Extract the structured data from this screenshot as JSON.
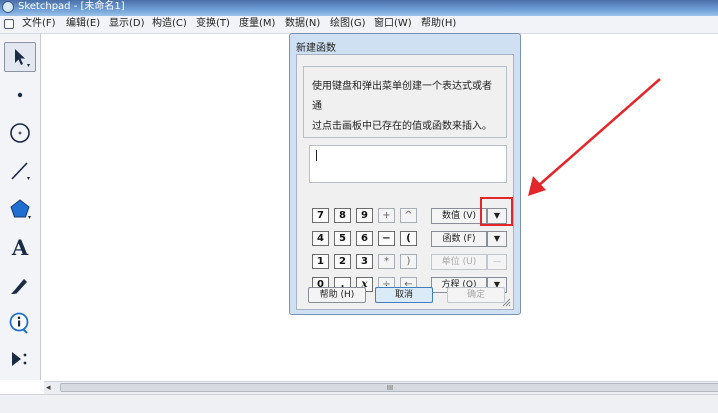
{
  "window": {
    "title": "Sketchpad - [未命名1]"
  },
  "menu": [
    "文件(F)",
    "编辑(E)",
    "显示(D)",
    "构造(C)",
    "变换(T)",
    "度量(M)",
    "数据(N)",
    "绘图(G)",
    "窗口(W)",
    "帮助(H)"
  ],
  "toolbox": {
    "tools": [
      "arrow-select-tool",
      "point-tool",
      "compass-tool",
      "straightedge-tool",
      "polygon-tool",
      "text-tool",
      "marker-tool",
      "information-tool",
      "custom-tool"
    ],
    "text_tool_glyph": "A"
  },
  "scrollbar": {
    "grip": "III"
  },
  "dialog": {
    "title": "新建函数",
    "instructions_line1": "使用键盘和弹出菜单创建一个表达式或者通",
    "instructions_line2": "过点击画板中已存在的值或函数来插入。",
    "expression_value": "",
    "keypad": {
      "r1": [
        "7",
        "8",
        "9",
        "+",
        "^"
      ],
      "r2": [
        "4",
        "5",
        "6",
        "−",
        "("
      ],
      "r3": [
        "1",
        "2",
        "3",
        "*",
        ")"
      ],
      "r4": [
        "0",
        ".",
        "x",
        "÷",
        "←"
      ]
    },
    "dropdowns": {
      "value": "数值 (V)",
      "function": "函数 (F)",
      "unit": "单位 (U)",
      "equation": "方程 (Q)",
      "arrow": "▼",
      "arrow_disabled": "—"
    },
    "buttons": {
      "help": "帮助 (H)",
      "cancel": "取消",
      "ok": "确定"
    }
  },
  "annotations": {
    "highlight_color": "#e3262a"
  }
}
